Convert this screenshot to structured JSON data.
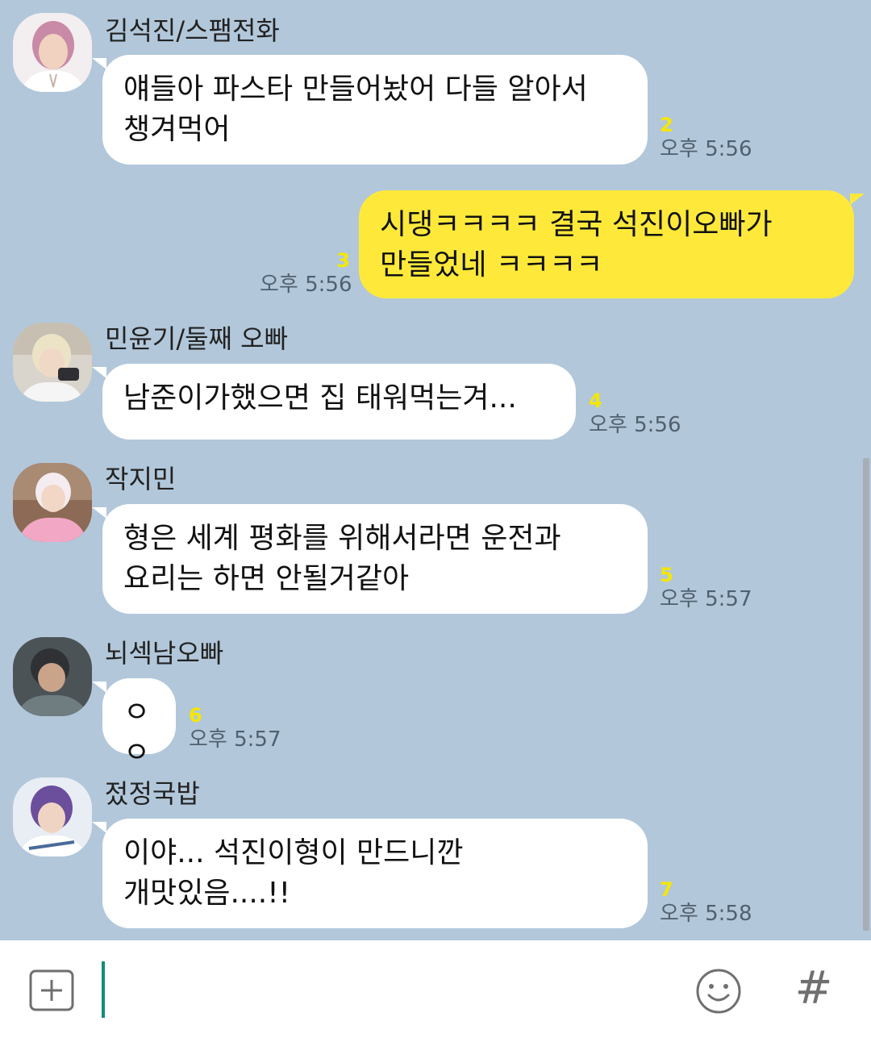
{
  "messages": [
    {
      "sender": "김석진/스팸전화",
      "avatar": "avatar-jin",
      "text": "얘들아 파스타 만들어놨어 다들 알아서\n챙겨먹어",
      "unread": "2",
      "time": "오후 5:56"
    },
    {
      "sender": "",
      "avatar": "",
      "text": "시댕ㅋㅋㅋㅋ 결국 석진이오빠가\n만들었네 ㅋㅋㅋㅋ",
      "unread": "3",
      "time": "오후 5:56"
    },
    {
      "sender": "민윤기/둘째 오빠",
      "avatar": "avatar-suga",
      "text": "남준이가했으면 집 태워먹는겨...",
      "unread": "4",
      "time": "오후 5:56"
    },
    {
      "sender": "작지민",
      "avatar": "avatar-jimin",
      "text": "형은 세계 평화를 위해서라면 운전과\n요리는 하면 안될거같아",
      "unread": "5",
      "time": "오후 5:57"
    },
    {
      "sender": "뇌섹남오빠",
      "avatar": "avatar-rm",
      "text": "ㅇㅇ",
      "unread": "6",
      "time": "오후 5:57"
    },
    {
      "sender": "젔정국밥",
      "avatar": "avatar-jungkook",
      "text": "이야... 석진이형이 만드니깐\n개맛있음....!!",
      "unread": "7",
      "time": "오후 5:58"
    }
  ],
  "input": {
    "value": "",
    "placeholder": ""
  },
  "toolbar": {
    "hash_label": "#"
  },
  "colors": {
    "chat_background": "#b2c7da",
    "my_bubble": "#fee93b",
    "other_bubble": "#ffffff",
    "unread_count": "#f5e700",
    "caret": "#128c7e"
  }
}
